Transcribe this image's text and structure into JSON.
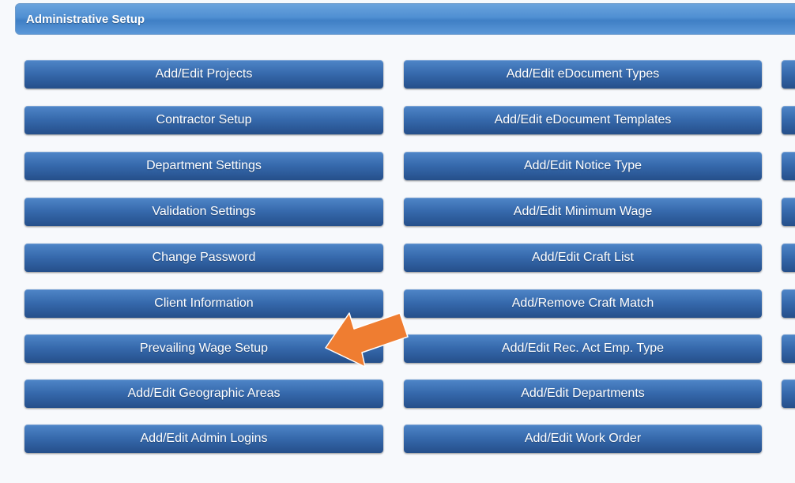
{
  "header": {
    "title": "Administrative Setup"
  },
  "columns": {
    "left": [
      "Add/Edit Projects",
      "Contractor Setup",
      "Department Settings",
      "Validation Settings",
      "Change Password",
      "Client Information",
      "Prevailing Wage Setup",
      "Add/Edit Geographic Areas",
      "Add/Edit Admin Logins"
    ],
    "middle": [
      "Add/Edit eDocument Types",
      "Add/Edit eDocument Templates",
      "Add/Edit Notice Type",
      "Add/Edit Minimum Wage",
      "Add/Edit Craft List",
      "Add/Remove Craft Match",
      "Add/Edit Rec. Act Emp. Type",
      "Add/Edit Departments",
      "Add/Edit Work Order"
    ],
    "right_visible_count": 8
  },
  "colors": {
    "header": "#4f8fd2",
    "button": "#3568ab",
    "arrow": "#ef7d31"
  },
  "annotation": {
    "icon": "pointer-arrow-icon"
  }
}
